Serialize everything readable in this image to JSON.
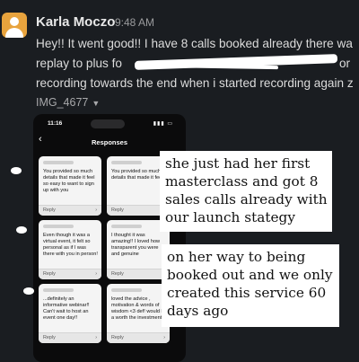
{
  "message": {
    "sender": "Karla Moczo",
    "time": "9:48 AM",
    "lines": [
      "Hey!! It went good!! I have 8 calls booked already there wa",
      "replay to plus fo",
      "recording towards the end when i started recording again z"
    ],
    "line2_tail": "or"
  },
  "attachment": {
    "filename": "IMG_4677"
  },
  "phone": {
    "status_time": "11:16",
    "title": "Responses",
    "cards": [
      {
        "text": "You provided so much details that made it feel so easy to want to sign up with you",
        "footer": "Reply"
      },
      {
        "text": "You provided so much details that made it feel",
        "footer": "Reply"
      },
      {
        "text": "Even though it was a virtual event, it felt so personal as if I was there with you in person!",
        "footer": "Reply"
      },
      {
        "text": "I thought it was amazing!! I loved how transparent you were and genuine",
        "footer": "Reply"
      },
      {
        "text": "...definitely an informative webinar!! Can't wait to host an event one day!!",
        "footer": "Reply"
      },
      {
        "text": "loved the advice , motivation & words of wisdom <3 def! would b a worth the investment!",
        "footer": "Reply"
      }
    ]
  },
  "overlays": {
    "first": [
      "she just had her first",
      "masterclass and got 8",
      "sales calls already with",
      "our launch stategy"
    ],
    "second": [
      "on her way to being",
      "booked out and we only",
      "created this service 60",
      "days ago"
    ]
  },
  "colors": {
    "background": "#1a1d21",
    "avatar": "#e8a33d",
    "overlay": "#ffffff"
  }
}
